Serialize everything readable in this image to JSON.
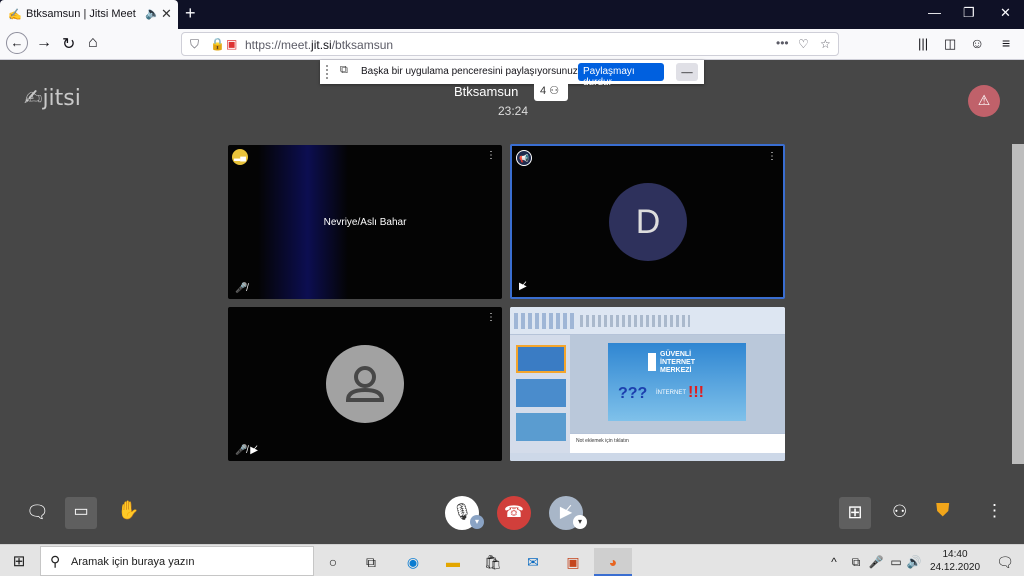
{
  "browser": {
    "tab_title": "Btksamsun | Jitsi Meet",
    "url_prefix": "https://meet.",
    "url_domain": "jit.si",
    "url_path": "/btksamsun",
    "more_label": "•••"
  },
  "share_banner": {
    "message": "Başka bir uygulama penceresini paylaşıyorsunuz.",
    "stop_label": "Paylaşmayı durdur",
    "hide_label": "__"
  },
  "conference": {
    "logo": "jitsi",
    "name": "Btksamsun",
    "participant_count": "4",
    "timer": "23:24"
  },
  "tiles": [
    {
      "name": "Nevriye/Aslı Bahar"
    },
    {
      "initial": "D"
    }
  ],
  "slide": {
    "line1": "GÜVENLİ",
    "line2": "İNTERNET",
    "line3": "MERKEZİ",
    "question": "???",
    "word": "İNTERNET",
    "exclaim": "!!!",
    "notes": "Not eklemek için tıklatın"
  },
  "taskbar": {
    "search_placeholder": "Aramak için buraya yazın",
    "time": "14:40",
    "date": "24.12.2020"
  },
  "colors": {
    "hangup": "#d13f3b",
    "warn": "#c0616a",
    "active_border": "#3a6ed1",
    "shield": "#f2a61a"
  }
}
